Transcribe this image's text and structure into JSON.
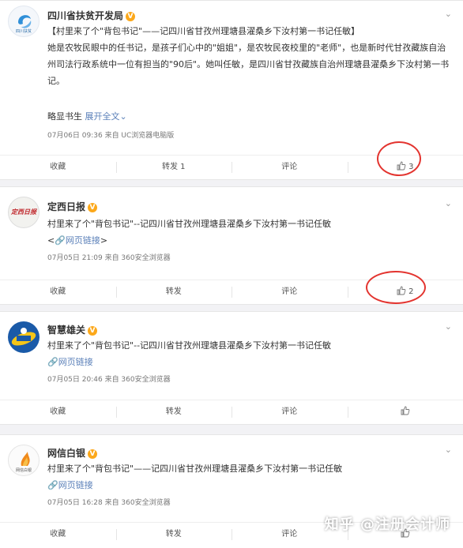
{
  "posts": [
    {
      "account_name": "四川省扶贫开发局",
      "avatar_caption": "四川扶贫",
      "headline": "【村里来了个\"背包书记\"——记四川省甘孜州理塘县濯桑乡下汝村第一书记任敏】",
      "body": "她是农牧民眼中的任书记，是孩子们心中的\"姐姐\"，是农牧民夜校里的\"老师\"，也是新时代甘孜藏族自治州司法行政系统中一位有担当的\"90后\"。她叫任敏，是四川省甘孜藏族自治州理塘县濯桑乡下汝村第一书记。",
      "author_sign": "略显书生",
      "expand_label": "展开全文",
      "meta": "07月06日 09:36 来自 UC浏览器电脑版",
      "actions": {
        "favorite": "收藏",
        "repost": "转发 1",
        "comment": "评论",
        "like_count": "3"
      }
    },
    {
      "account_name": "定西日报",
      "avatar_caption": "定西日报",
      "text": "村里来了个\"背包书记\"--记四川省甘孜州理塘县濯桑乡下汝村第一书记任敏",
      "link_label": "网页链接",
      "link_prefix": "<",
      "link_suffix": ">",
      "meta": "07月05日 21:09 来自 360安全浏览器",
      "actions": {
        "favorite": "收藏",
        "repost": "转发",
        "comment": "评论",
        "like_count": "2"
      }
    },
    {
      "account_name": "智慧雄关",
      "text": "村里来了个\"背包书记\"--记四川省甘孜州理塘县濯桑乡下汝村第一书记任敏",
      "link_label": "网页链接",
      "meta": "07月05日 20:46 来自 360安全浏览器",
      "actions": {
        "favorite": "收藏",
        "repost": "转发",
        "comment": "评论",
        "like_count": ""
      }
    },
    {
      "account_name": "网信白银",
      "avatar_caption": "网信白银",
      "text": "村里来了个\"背包书记\"——记四川省甘孜州理塘县濯桑乡下汝村第一书记任敏",
      "link_label": "网页链接",
      "meta": "07月05日 16:28 来自 360安全浏览器",
      "actions": {
        "favorite": "收藏",
        "repost": "转发",
        "comment": "评论",
        "like_count": ""
      }
    }
  ],
  "watermark": "知乎 @注册会计师",
  "colors": {
    "link": "#eb7350",
    "blue_link": "#5b80b9",
    "verify_badge": "#fca81a",
    "highlight_circle": "#e3342f"
  },
  "icons": {
    "verify": "verified-v-icon",
    "like": "thumbs-up-icon",
    "chevron": "chevron-down-icon",
    "link": "link-icon"
  }
}
